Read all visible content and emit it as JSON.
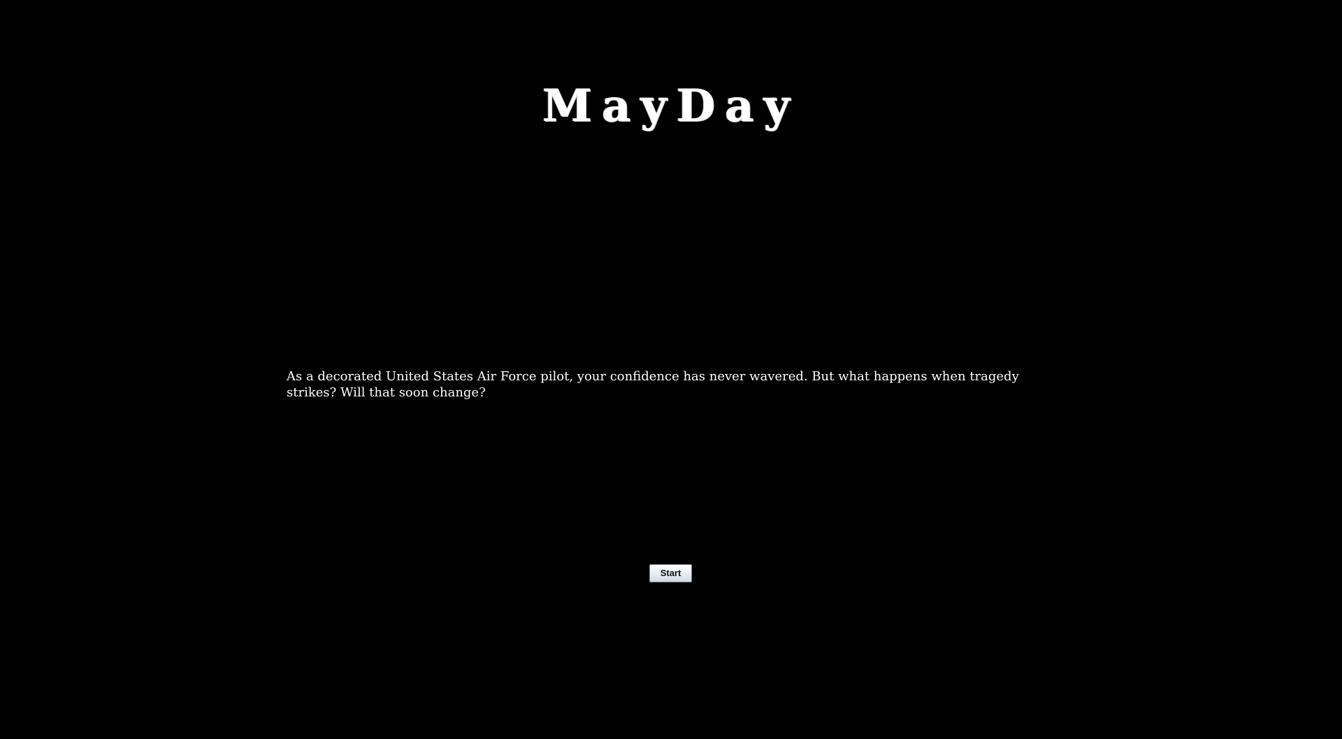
{
  "game": {
    "title": "MayDay",
    "intro_text": "As a decorated United States Air Force pilot, your confidence has never wavered. But what happens when tragedy strikes? Will that soon change?",
    "start_label": "Start"
  },
  "colors": {
    "background": "#000000",
    "text": "#ffffff"
  }
}
